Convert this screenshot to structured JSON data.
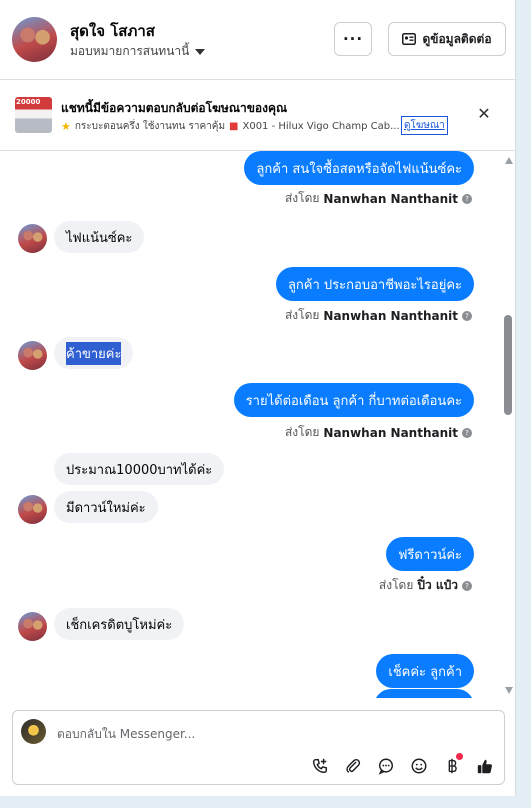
{
  "header": {
    "name": "สุดใจ โสภาส",
    "assign_label": "มอบหมายการสนทนานี้",
    "more_label": "···",
    "contact_label": "ดูข้อมูลติดต่อ"
  },
  "ad_banner": {
    "title": "แชทนี้มีข้อความตอบกลับต่อโฆษณาของคุณ",
    "thumb_price": "20000",
    "detail_a": "กระบะตอนครึ่ง ใช้งานทน ราคาคุ้ม",
    "detail_b": "X001 - Hilux Vigo Champ Cab...",
    "link_label": "ดูโฆษณา"
  },
  "messages": [
    {
      "dir": "out",
      "text": "ลูกค้า สนใจซื้อสดหรือจัดไฟแน้นซ์คะ"
    },
    {
      "dir": "sent_by",
      "prefix": "ส่งโดย",
      "name": "Nanwhan Nanthanit"
    },
    {
      "dir": "in",
      "text": "ไฟแน้นซ์คะ"
    },
    {
      "dir": "out",
      "text": "ลูกค้า ประกอบอาชีพอะไรอยู่คะ"
    },
    {
      "dir": "sent_by",
      "prefix": "ส่งโดย",
      "name": "Nanwhan Nanthanit"
    },
    {
      "dir": "in",
      "text": "ค้าขายค่ะ"
    },
    {
      "dir": "out",
      "text": "รายได้ต่อเดือน  ลูกค้า  กี่บาทต่อเดือนคะ"
    },
    {
      "dir": "sent_by",
      "prefix": "ส่งโดย",
      "name": "Nanwhan Nanthanit"
    },
    {
      "dir": "in",
      "text": "ประมาณ10000บาทได้ค่ะ"
    },
    {
      "dir": "in",
      "text": "มีดาวน์ใหม่ค่ะ"
    },
    {
      "dir": "out",
      "text": "ฟรีดาวน์ค่ะ"
    },
    {
      "dir": "sent_by",
      "prefix": "ส่งโดย",
      "name": "ปิ๋ว แป๋ว"
    },
    {
      "dir": "in",
      "text": "เช็กเครดิตบูโหม่ค่ะ"
    },
    {
      "dir": "out",
      "text": "เช็คค่ะ  ลูกค้า"
    }
  ],
  "composer": {
    "placeholder": "ตอบกลับใน Messenger..."
  },
  "icons": {
    "more": "more-icon",
    "contact": "contact-card-icon",
    "close": "close-icon",
    "info": "info-icon",
    "call": "add-call-icon",
    "attach": "paperclip-icon",
    "saved_replies": "chat-bubble-icon",
    "emoji": "emoji-icon",
    "payment": "baht-icon",
    "like": "thumbs-up-icon"
  },
  "colors": {
    "outgoing_bubble": "#0a7cff",
    "incoming_bubble": "#f0f2f5",
    "selection": "#2f5fd0",
    "notification_dot": "#f02849"
  }
}
